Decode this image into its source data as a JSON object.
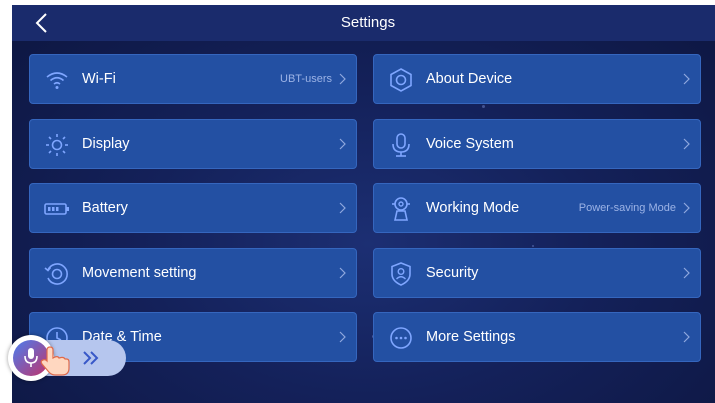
{
  "header": {
    "title": "Settings"
  },
  "left_items": [
    {
      "label": "Wi-Fi",
      "value": "UBT-users",
      "icon": "wifi-icon"
    },
    {
      "label": "Display",
      "value": "",
      "icon": "brightness-icon"
    },
    {
      "label": "Battery",
      "value": "",
      "icon": "battery-icon"
    },
    {
      "label": "Movement setting",
      "value": "",
      "icon": "movement-icon"
    },
    {
      "label": "Date & Time",
      "value": "",
      "icon": "clock-icon"
    }
  ],
  "right_items": [
    {
      "label": "About Device",
      "value": "",
      "icon": "device-icon"
    },
    {
      "label": "Voice System",
      "value": "",
      "icon": "microphone-icon"
    },
    {
      "label": "Working Mode",
      "value": "Power-saving Mode",
      "icon": "robot-icon"
    },
    {
      "label": "Security",
      "value": "",
      "icon": "shield-user-icon"
    },
    {
      "label": "More Settings",
      "value": "",
      "icon": "more-icon"
    }
  ],
  "colors": {
    "card": "#2350a3",
    "background": "#14215a",
    "topbar": "#1a2b6c",
    "text": "#ffffff",
    "value_text": "#9cb3e6"
  }
}
